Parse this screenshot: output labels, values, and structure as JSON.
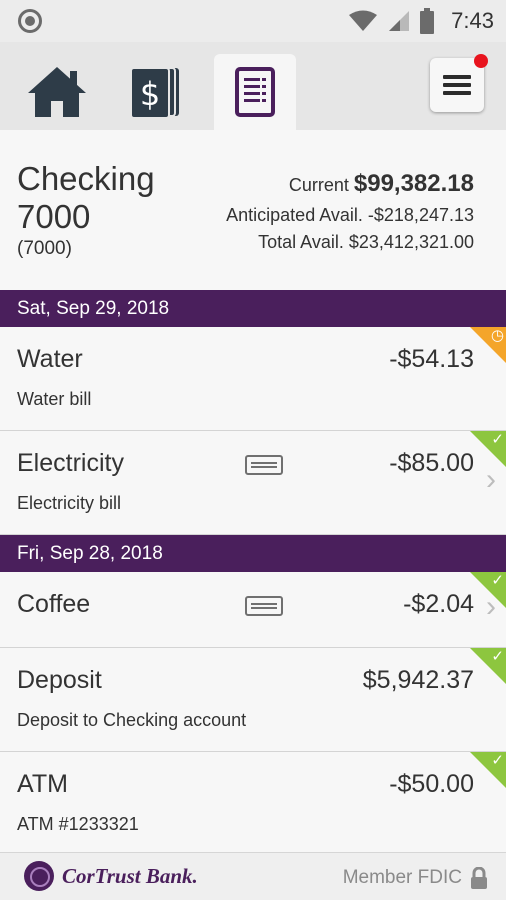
{
  "status_bar": {
    "time": "7:43",
    "icons": [
      "record-icon",
      "wifi-icon",
      "signal-icon",
      "battery-icon"
    ]
  },
  "tabs": [
    {
      "name": "home",
      "icon": "home-icon",
      "active": false
    },
    {
      "name": "accounts",
      "icon": "money-icon",
      "active": false
    },
    {
      "name": "transactions",
      "icon": "list-icon",
      "active": true
    }
  ],
  "account": {
    "name": "Checking 7000",
    "number": "(7000)",
    "current_label": "Current",
    "current_value": "$99,382.18",
    "anticipated_line": "Anticipated Avail. -$218,247.13",
    "total_line": "Total Avail. $23,412,321.00"
  },
  "groups": [
    {
      "date": "Sat, Sep 29, 2018",
      "transactions": [
        {
          "title": "Water",
          "description": "Water bill",
          "amount": "-$54.13",
          "status": "pending"
        },
        {
          "title": "Electricity",
          "description": "Electricity bill",
          "amount": "-$85.00",
          "status": "cleared"
        }
      ]
    },
    {
      "date": "Fri, Sep 28, 2018",
      "transactions": [
        {
          "title": "Coffee",
          "description": "",
          "amount": "-$2.04",
          "status": "cleared"
        },
        {
          "title": "Deposit",
          "description": "Deposit to Checking account",
          "amount": "$5,942.37",
          "status": "cleared"
        },
        {
          "title": "ATM",
          "description": "ATM #1233321",
          "amount": "-$50.00",
          "status": "cleared"
        }
      ]
    }
  ],
  "footer": {
    "bank_name": "CorTrust Bank.",
    "member_fdic": "Member FDIC"
  },
  "colors": {
    "brand_purple": "#4a1f5c",
    "cleared_green": "#8dc63f",
    "pending_orange": "#f4a52a",
    "notification_red": "#e8141e"
  }
}
